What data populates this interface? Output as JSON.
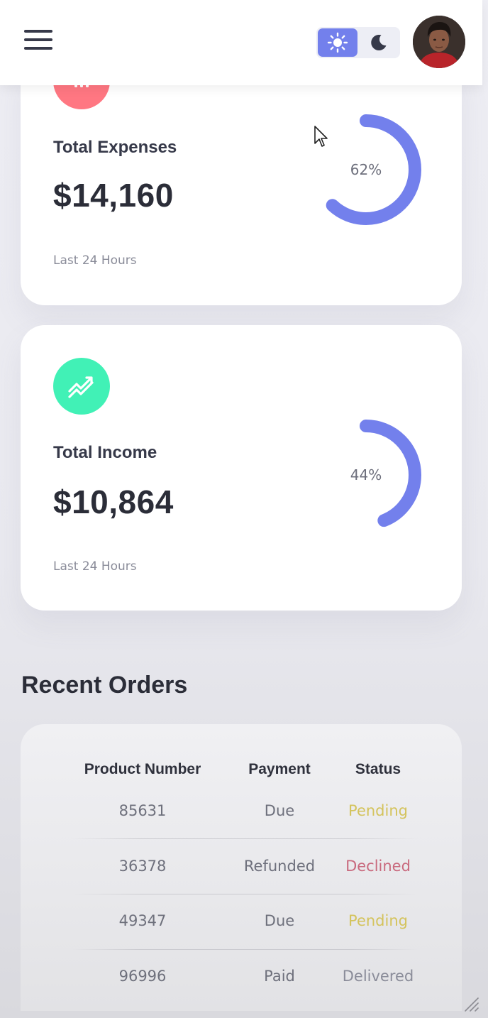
{
  "header": {
    "menu_icon": "hamburger-menu-icon",
    "theme_toggle": {
      "light_icon": "sun-icon",
      "dark_icon": "moon-icon",
      "active": "light"
    },
    "avatar_icon": "profile-avatar"
  },
  "colors": {
    "primary": "#7380ec",
    "danger": "#ff7782",
    "success": "#41f1b6",
    "warning": "#d4c35c",
    "declined": "#c96a7e",
    "text_dark": "#363949",
    "text_muted": "#8a8c99"
  },
  "cards": [
    {
      "title": "Total Expenses",
      "amount": "$14,160",
      "period": "Last 24 Hours",
      "percent_label": "62%",
      "percent": 62,
      "icon": "bar-chart-icon"
    },
    {
      "title": "Total Income",
      "amount": "$10,864",
      "period": "Last 24 Hours",
      "percent_label": "44%",
      "percent": 44,
      "icon": "trending-up-icon"
    }
  ],
  "recent_orders": {
    "title": "Recent Orders",
    "columns": [
      "Product Number",
      "Payment",
      "Status"
    ],
    "rows": [
      {
        "product": "85631",
        "payment": "Due",
        "status": "Pending"
      },
      {
        "product": "36378",
        "payment": "Refunded",
        "status": "Declined"
      },
      {
        "product": "49347",
        "payment": "Due",
        "status": "Pending"
      },
      {
        "product": "96996",
        "payment": "Paid",
        "status": "Delivered"
      }
    ]
  }
}
